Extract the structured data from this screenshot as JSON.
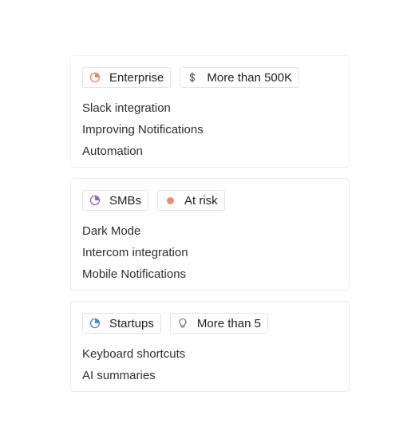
{
  "cards": [
    {
      "tags": [
        {
          "icon": "pie-chart-icon",
          "color": "#e8845f",
          "label": "Enterprise"
        },
        {
          "icon": "dollar-icon",
          "color": "#555555",
          "label": "More than 500K"
        }
      ],
      "items": [
        "Slack integration",
        "Improving Notifications",
        "Automation"
      ]
    },
    {
      "tags": [
        {
          "icon": "pie-chart-icon",
          "color": "#8a63d2",
          "label": "SMBs"
        },
        {
          "icon": "status-dot-icon",
          "color": "#f28a6f",
          "label": "At risk"
        }
      ],
      "items": [
        "Dark Mode",
        "Intercom integration",
        "Mobile Notifications"
      ]
    },
    {
      "tags": [
        {
          "icon": "pie-chart-icon",
          "color": "#4f86d9",
          "label": "Startups"
        },
        {
          "icon": "lightbulb-icon",
          "color": "#666666",
          "label": "More than 5"
        }
      ],
      "items": [
        "Keyboard shortcuts",
        "AI summaries"
      ]
    }
  ]
}
